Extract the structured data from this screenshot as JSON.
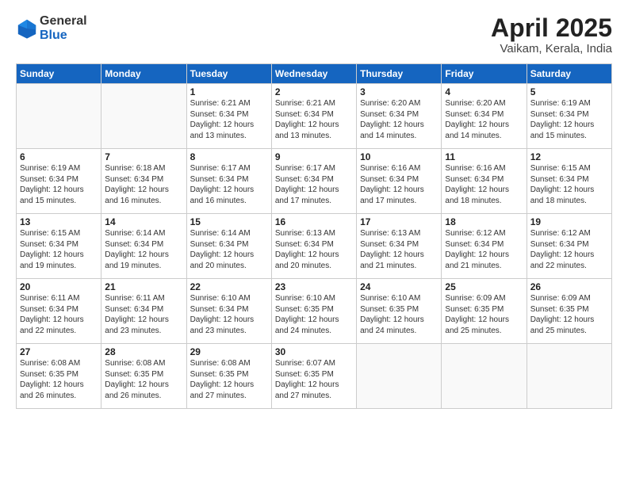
{
  "header": {
    "logo_general": "General",
    "logo_blue": "Blue",
    "month_title": "April 2025",
    "location": "Vaikam, Kerala, India"
  },
  "weekdays": [
    "Sunday",
    "Monday",
    "Tuesday",
    "Wednesday",
    "Thursday",
    "Friday",
    "Saturday"
  ],
  "rows": [
    [
      {
        "day": "",
        "info": ""
      },
      {
        "day": "",
        "info": ""
      },
      {
        "day": "1",
        "info": "Sunrise: 6:21 AM\nSunset: 6:34 PM\nDaylight: 12 hours and 13 minutes."
      },
      {
        "day": "2",
        "info": "Sunrise: 6:21 AM\nSunset: 6:34 PM\nDaylight: 12 hours and 13 minutes."
      },
      {
        "day": "3",
        "info": "Sunrise: 6:20 AM\nSunset: 6:34 PM\nDaylight: 12 hours and 14 minutes."
      },
      {
        "day": "4",
        "info": "Sunrise: 6:20 AM\nSunset: 6:34 PM\nDaylight: 12 hours and 14 minutes."
      },
      {
        "day": "5",
        "info": "Sunrise: 6:19 AM\nSunset: 6:34 PM\nDaylight: 12 hours and 15 minutes."
      }
    ],
    [
      {
        "day": "6",
        "info": "Sunrise: 6:19 AM\nSunset: 6:34 PM\nDaylight: 12 hours and 15 minutes."
      },
      {
        "day": "7",
        "info": "Sunrise: 6:18 AM\nSunset: 6:34 PM\nDaylight: 12 hours and 16 minutes."
      },
      {
        "day": "8",
        "info": "Sunrise: 6:17 AM\nSunset: 6:34 PM\nDaylight: 12 hours and 16 minutes."
      },
      {
        "day": "9",
        "info": "Sunrise: 6:17 AM\nSunset: 6:34 PM\nDaylight: 12 hours and 17 minutes."
      },
      {
        "day": "10",
        "info": "Sunrise: 6:16 AM\nSunset: 6:34 PM\nDaylight: 12 hours and 17 minutes."
      },
      {
        "day": "11",
        "info": "Sunrise: 6:16 AM\nSunset: 6:34 PM\nDaylight: 12 hours and 18 minutes."
      },
      {
        "day": "12",
        "info": "Sunrise: 6:15 AM\nSunset: 6:34 PM\nDaylight: 12 hours and 18 minutes."
      }
    ],
    [
      {
        "day": "13",
        "info": "Sunrise: 6:15 AM\nSunset: 6:34 PM\nDaylight: 12 hours and 19 minutes."
      },
      {
        "day": "14",
        "info": "Sunrise: 6:14 AM\nSunset: 6:34 PM\nDaylight: 12 hours and 19 minutes."
      },
      {
        "day": "15",
        "info": "Sunrise: 6:14 AM\nSunset: 6:34 PM\nDaylight: 12 hours and 20 minutes."
      },
      {
        "day": "16",
        "info": "Sunrise: 6:13 AM\nSunset: 6:34 PM\nDaylight: 12 hours and 20 minutes."
      },
      {
        "day": "17",
        "info": "Sunrise: 6:13 AM\nSunset: 6:34 PM\nDaylight: 12 hours and 21 minutes."
      },
      {
        "day": "18",
        "info": "Sunrise: 6:12 AM\nSunset: 6:34 PM\nDaylight: 12 hours and 21 minutes."
      },
      {
        "day": "19",
        "info": "Sunrise: 6:12 AM\nSunset: 6:34 PM\nDaylight: 12 hours and 22 minutes."
      }
    ],
    [
      {
        "day": "20",
        "info": "Sunrise: 6:11 AM\nSunset: 6:34 PM\nDaylight: 12 hours and 22 minutes."
      },
      {
        "day": "21",
        "info": "Sunrise: 6:11 AM\nSunset: 6:34 PM\nDaylight: 12 hours and 23 minutes."
      },
      {
        "day": "22",
        "info": "Sunrise: 6:10 AM\nSunset: 6:34 PM\nDaylight: 12 hours and 23 minutes."
      },
      {
        "day": "23",
        "info": "Sunrise: 6:10 AM\nSunset: 6:35 PM\nDaylight: 12 hours and 24 minutes."
      },
      {
        "day": "24",
        "info": "Sunrise: 6:10 AM\nSunset: 6:35 PM\nDaylight: 12 hours and 24 minutes."
      },
      {
        "day": "25",
        "info": "Sunrise: 6:09 AM\nSunset: 6:35 PM\nDaylight: 12 hours and 25 minutes."
      },
      {
        "day": "26",
        "info": "Sunrise: 6:09 AM\nSunset: 6:35 PM\nDaylight: 12 hours and 25 minutes."
      }
    ],
    [
      {
        "day": "27",
        "info": "Sunrise: 6:08 AM\nSunset: 6:35 PM\nDaylight: 12 hours and 26 minutes."
      },
      {
        "day": "28",
        "info": "Sunrise: 6:08 AM\nSunset: 6:35 PM\nDaylight: 12 hours and 26 minutes."
      },
      {
        "day": "29",
        "info": "Sunrise: 6:08 AM\nSunset: 6:35 PM\nDaylight: 12 hours and 27 minutes."
      },
      {
        "day": "30",
        "info": "Sunrise: 6:07 AM\nSunset: 6:35 PM\nDaylight: 12 hours and 27 minutes."
      },
      {
        "day": "",
        "info": ""
      },
      {
        "day": "",
        "info": ""
      },
      {
        "day": "",
        "info": ""
      }
    ]
  ]
}
